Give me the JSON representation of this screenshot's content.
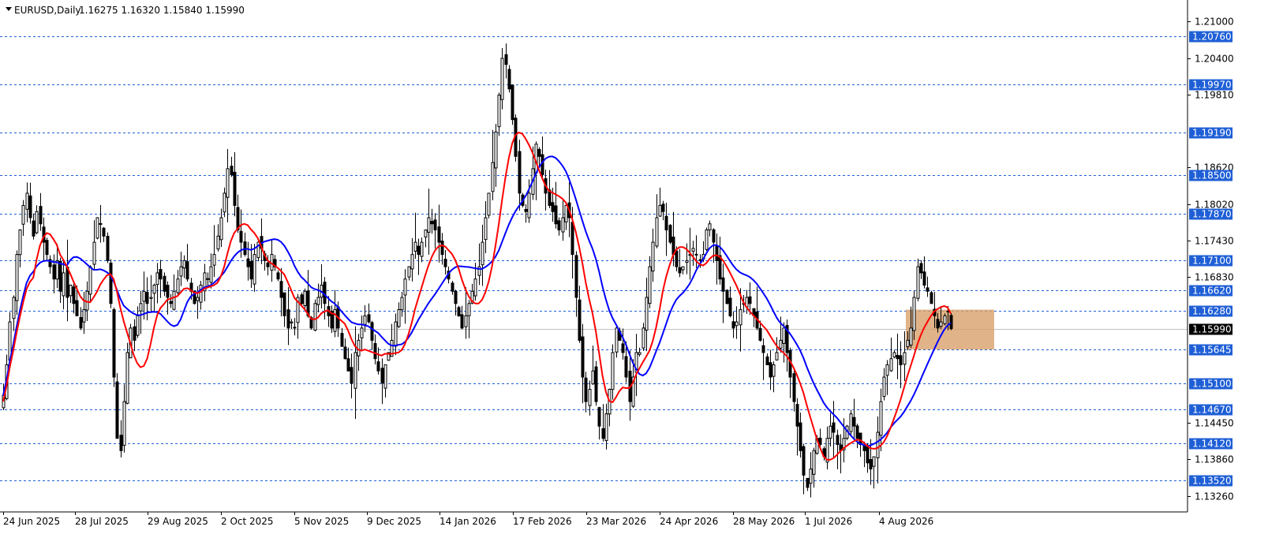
{
  "header": {
    "symbol_timeframe": "EURUSD,Daily",
    "ohlc": "1.16275 1.16320 1.15840 1.15990"
  },
  "colors": {
    "grid_dashed": "#1f5fd6",
    "badge_bg": "#1f5fd6",
    "badge_text": "#ffffff",
    "current_bg": "#000000",
    "current_text": "#ffffff",
    "ma_fast": "#ff0000",
    "ma_slow": "#0000ff",
    "zone": "#d8a06a",
    "candles": "#000000",
    "current_line": "#c0c0c0"
  },
  "chart_data": {
    "type": "candlestick",
    "symbol": "EURUSD",
    "timeframe": "Daily",
    "ylim": [
      1.13,
      1.213
    ],
    "y_ticks": [
      "1.21000",
      "1.20400",
      "1.19810",
      "1.18620",
      "1.18020",
      "1.17430",
      "1.16830",
      "1.14450",
      "1.13860",
      "1.13260"
    ],
    "levels": [
      "1.20760",
      "1.19970",
      "1.19190",
      "1.18500",
      "1.17870",
      "1.17100",
      "1.16620",
      "1.16280",
      "1.15645",
      "1.15100",
      "1.14670",
      "1.14120",
      "1.13520"
    ],
    "current_price": "1.15990",
    "x_ticks": [
      "24 Jun 2025",
      "28 Jul 2025",
      "29 Aug 2025",
      "2 Oct 2025",
      "5 Nov 2025",
      "9 Dec 2025",
      "14 Jan 2026",
      "17 Feb 2026",
      "23 Mar 2026",
      "24 Apr 2026",
      "28 May 2026",
      "1 Jul 2026",
      "4 Aug 2026"
    ],
    "zone": {
      "price_top": 1.163,
      "price_bottom": 1.1565
    },
    "closes": [
      1.149,
      1.154,
      1.161,
      1.165,
      1.172,
      1.176,
      1.18,
      1.182,
      1.178,
      1.175,
      1.179,
      1.177,
      1.174,
      1.172,
      1.17,
      1.168,
      1.171,
      1.166,
      1.169,
      1.165,
      1.167,
      1.164,
      1.162,
      1.16,
      1.163,
      1.166,
      1.17,
      1.174,
      1.178,
      1.177,
      1.175,
      1.171,
      1.164,
      1.152,
      1.142,
      1.14,
      1.148,
      1.156,
      1.16,
      1.158,
      1.162,
      1.164,
      1.166,
      1.164,
      1.165,
      1.167,
      1.169,
      1.168,
      1.166,
      1.165,
      1.164,
      1.166,
      1.168,
      1.17,
      1.171,
      1.168,
      1.166,
      1.164,
      1.165,
      1.167,
      1.169,
      1.168,
      1.17,
      1.172,
      1.175,
      1.178,
      1.182,
      1.186,
      1.185,
      1.18,
      1.176,
      1.174,
      1.172,
      1.17,
      1.168,
      1.172,
      1.174,
      1.173,
      1.171,
      1.17,
      1.172,
      1.17,
      1.168,
      1.165,
      1.162,
      1.16,
      1.161,
      1.16,
      1.165,
      1.164,
      1.166,
      1.162,
      1.16,
      1.164,
      1.165,
      1.167,
      1.164,
      1.162,
      1.16,
      1.163,
      1.16,
      1.157,
      1.155,
      1.153,
      1.151,
      1.156,
      1.158,
      1.16,
      1.162,
      1.161,
      1.158,
      1.155,
      1.153,
      1.151,
      1.154,
      1.156,
      1.158,
      1.161,
      1.163,
      1.165,
      1.168,
      1.17,
      1.172,
      1.174,
      1.172,
      1.174,
      1.176,
      1.178,
      1.177,
      1.176,
      1.174,
      1.172,
      1.17,
      1.168,
      1.166,
      1.164,
      1.162,
      1.16,
      1.162,
      1.164,
      1.166,
      1.168,
      1.17,
      1.174,
      1.178,
      1.182,
      1.187,
      1.192,
      1.198,
      1.204,
      1.203,
      1.199,
      1.194,
      1.188,
      1.182,
      1.18,
      1.179,
      1.182,
      1.186,
      1.19,
      1.188,
      1.185,
      1.182,
      1.18,
      1.179,
      1.177,
      1.176,
      1.178,
      1.18,
      1.178,
      1.172,
      1.165,
      1.158,
      1.152,
      1.148,
      1.15,
      1.153,
      1.148,
      1.144,
      1.142,
      1.146,
      1.15,
      1.156,
      1.16,
      1.158,
      1.156,
      1.152,
      1.148,
      1.152,
      1.156,
      1.156,
      1.16,
      1.165,
      1.17,
      1.174,
      1.178,
      1.18,
      1.179,
      1.176,
      1.174,
      1.172,
      1.17,
      1.169,
      1.17,
      1.171,
      1.172,
      1.173,
      1.172,
      1.171,
      1.172,
      1.176,
      1.177,
      1.174,
      1.171,
      1.168,
      1.166,
      1.164,
      1.162,
      1.16,
      1.161,
      1.163,
      1.164,
      1.165,
      1.164,
      1.162,
      1.16,
      1.158,
      1.156,
      1.154,
      1.152,
      1.154,
      1.156,
      1.158,
      1.16,
      1.156,
      1.152,
      1.148,
      1.144,
      1.14,
      1.136,
      1.134,
      1.137,
      1.14,
      1.142,
      1.141,
      1.139,
      1.142,
      1.144,
      1.143,
      1.141,
      1.14,
      1.142,
      1.144,
      1.146,
      1.144,
      1.142,
      1.141,
      1.14,
      1.138,
      1.137,
      1.139,
      1.143,
      1.148,
      1.152,
      1.154,
      1.155,
      1.156,
      1.155,
      1.154,
      1.156,
      1.158,
      1.16,
      1.165,
      1.17,
      1.169,
      1.167,
      1.166,
      1.164,
      1.162,
      1.16,
      1.161,
      1.162,
      1.1627,
      1.1599
    ],
    "series": [
      {
        "values_from": "closes",
        "period": 20,
        "color": "#0000ff"
      },
      {
        "values_from": "closes",
        "period": 10,
        "shift": 0.001,
        "color": "#ff0000"
      }
    ]
  }
}
